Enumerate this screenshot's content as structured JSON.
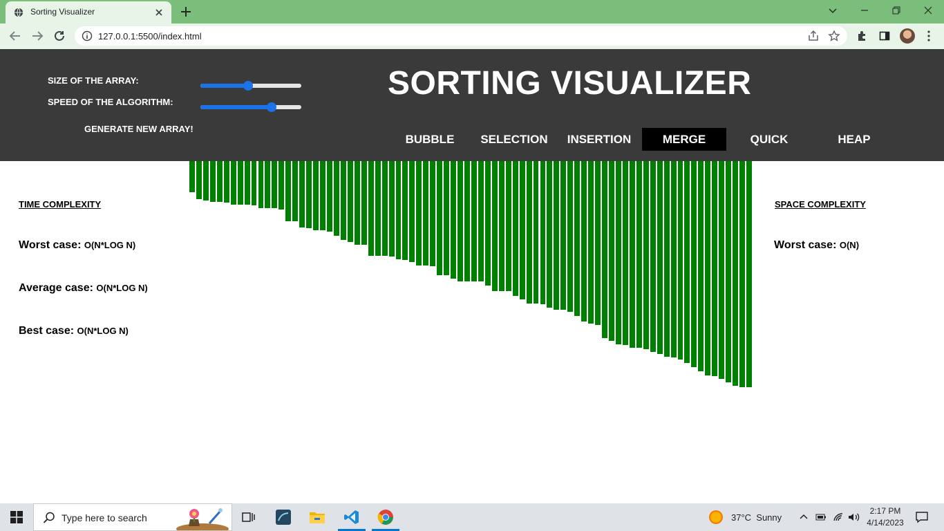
{
  "browser": {
    "tab_title": "Sorting Visualizer",
    "url": "127.0.0.1:5500/index.html"
  },
  "header": {
    "size_label": "SIZE OF THE ARRAY:",
    "speed_label": "SPEED OF THE ALGORITHM:",
    "size_value": 0.47,
    "speed_value": 0.73,
    "generate_label": "GENERATE NEW ARRAY!",
    "title": "SORTING VISUALIZER",
    "algorithms": [
      {
        "label": "BUBBLE",
        "active": false
      },
      {
        "label": "SELECTION",
        "active": false
      },
      {
        "label": "INSERTION",
        "active": false
      },
      {
        "label": "MERGE",
        "active": true
      },
      {
        "label": "QUICK",
        "active": false
      },
      {
        "label": "HEAP",
        "active": false
      }
    ]
  },
  "time_complexity": {
    "heading": "TIME COMPLEXITY",
    "worst_label": "Worst case:",
    "worst_value": "O(N*LOG N)",
    "average_label": "Average case:",
    "average_value": "O(N*LOG N)",
    "best_label": "Best case:",
    "best_value": "O(N*LOG N)"
  },
  "space_complexity": {
    "heading": "SPACE COMPLEXITY",
    "worst_label": "Worst case:",
    "worst_value": "O(N)"
  },
  "array_values": [
    45,
    55,
    57,
    59,
    59,
    60,
    63,
    63,
    63,
    64,
    68,
    68,
    68,
    70,
    87,
    87,
    96,
    97,
    100,
    100,
    102,
    108,
    114,
    117,
    121,
    121,
    137,
    137,
    137,
    138,
    142,
    143,
    146,
    151,
    151,
    152,
    165,
    165,
    170,
    174,
    174,
    174,
    174,
    180,
    188,
    188,
    188,
    195,
    200,
    206,
    206,
    207,
    212,
    215,
    215,
    218,
    224,
    232,
    235,
    237,
    256,
    260,
    265,
    266,
    270,
    270,
    272,
    276,
    279,
    283,
    284,
    287,
    292,
    298,
    304,
    310,
    311,
    315,
    320,
    325,
    327,
    327
  ],
  "colors": {
    "bar": "#008000",
    "header_bg": "#3a3a3a",
    "active_algo_bg": "#000000"
  },
  "taskbar": {
    "search_placeholder": "Type here to search",
    "weather": "37°C  Sunny",
    "time": "2:17 PM",
    "date": "4/14/2023"
  }
}
